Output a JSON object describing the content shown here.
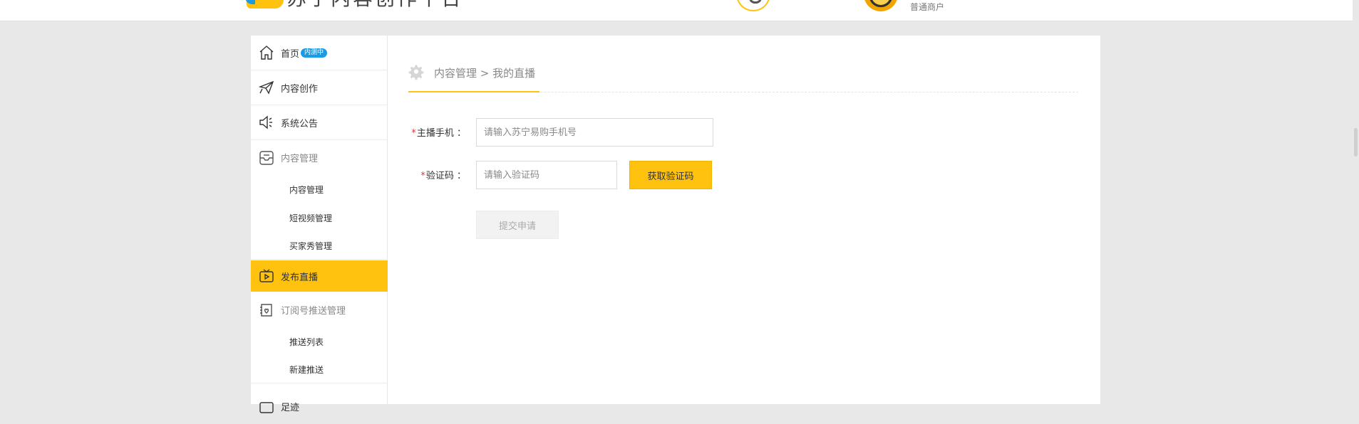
{
  "header": {
    "logo_text": "苏宁内容创作平台",
    "user_role": "普通商户"
  },
  "sidebar": {
    "items": [
      {
        "label": "首页",
        "badge": "内测中",
        "icon": "home-icon"
      },
      {
        "label": "内容创作",
        "icon": "paper-plane-icon"
      },
      {
        "label": "系统公告",
        "icon": "megaphone-icon"
      },
      {
        "label": "内容管理",
        "icon": "content-box-icon"
      },
      {
        "label": "发布直播",
        "icon": "tv-icon",
        "active": true
      },
      {
        "label": "订阅号推送管理",
        "icon": "subscribe-icon"
      }
    ],
    "content_sub": [
      "内容管理",
      "短视频管理",
      "买家秀管理"
    ],
    "push_sub": [
      "推送列表",
      "新建推送"
    ],
    "cut_item": "足迹"
  },
  "breadcrumb": {
    "text": "内容管理 > 我的直播"
  },
  "form": {
    "phone_label": "主播手机",
    "phone_placeholder": "请输入苏宁易购手机号",
    "code_label": "验证码",
    "code_placeholder": "请输入验证码",
    "get_code_button": "获取验证码",
    "submit_button": "提交申请",
    "required_mark": "*",
    "colon": "："
  },
  "colors": {
    "accent": "#ffc20e",
    "badge": "#1c9be3",
    "required": "#e4393c"
  }
}
